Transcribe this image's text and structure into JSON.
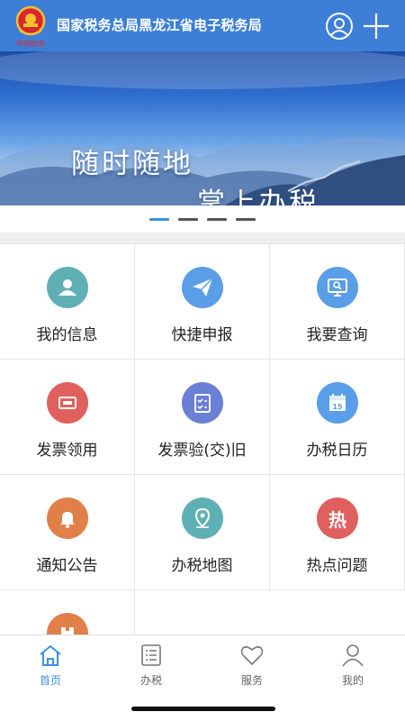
{
  "header": {
    "title": "国家税务总局黑龙江省电子税务局",
    "logo_text": "中国税务",
    "user_icon": "user-circle-icon",
    "add_icon": "plus-icon"
  },
  "banner": {
    "line1": "随时随地",
    "line2": "掌上办税",
    "slides": 4,
    "active_slide": 1
  },
  "grid": {
    "items": [
      {
        "label": "我的信息",
        "icon": "person-icon",
        "color": "#5fb0b4"
      },
      {
        "label": "快捷申报",
        "icon": "paper-plane-icon",
        "color": "#5a9ee8"
      },
      {
        "label": "我要查询",
        "icon": "monitor-search-icon",
        "color": "#5a9ee8"
      },
      {
        "label": "发票领用",
        "icon": "invoice-card-icon",
        "color": "#e0605e"
      },
      {
        "label": "发票验(交)旧",
        "icon": "checklist-icon",
        "color": "#6a7fd6"
      },
      {
        "label": "办税日历",
        "icon": "calendar-icon",
        "color": "#5a9ee8"
      },
      {
        "label": "通知公告",
        "icon": "bell-icon",
        "color": "#e08048"
      },
      {
        "label": "办税地图",
        "icon": "map-pin-icon",
        "color": "#5fb0b4"
      },
      {
        "label": "热点问题",
        "icon": "hot-topic-icon",
        "color": "#e0605e",
        "glyph": "热"
      },
      {
        "label": "",
        "icon": "partial-orange-icon",
        "color": "#e08048"
      }
    ],
    "calendar_day": "15"
  },
  "tabbar": {
    "tabs": [
      {
        "label": "首页",
        "icon": "home-icon"
      },
      {
        "label": "办税",
        "icon": "list-icon"
      },
      {
        "label": "服务",
        "icon": "heart-icon"
      },
      {
        "label": "我的",
        "icon": "person-outline-icon"
      }
    ],
    "active_color": "#3d8fe0",
    "inactive_color": "#666666"
  }
}
